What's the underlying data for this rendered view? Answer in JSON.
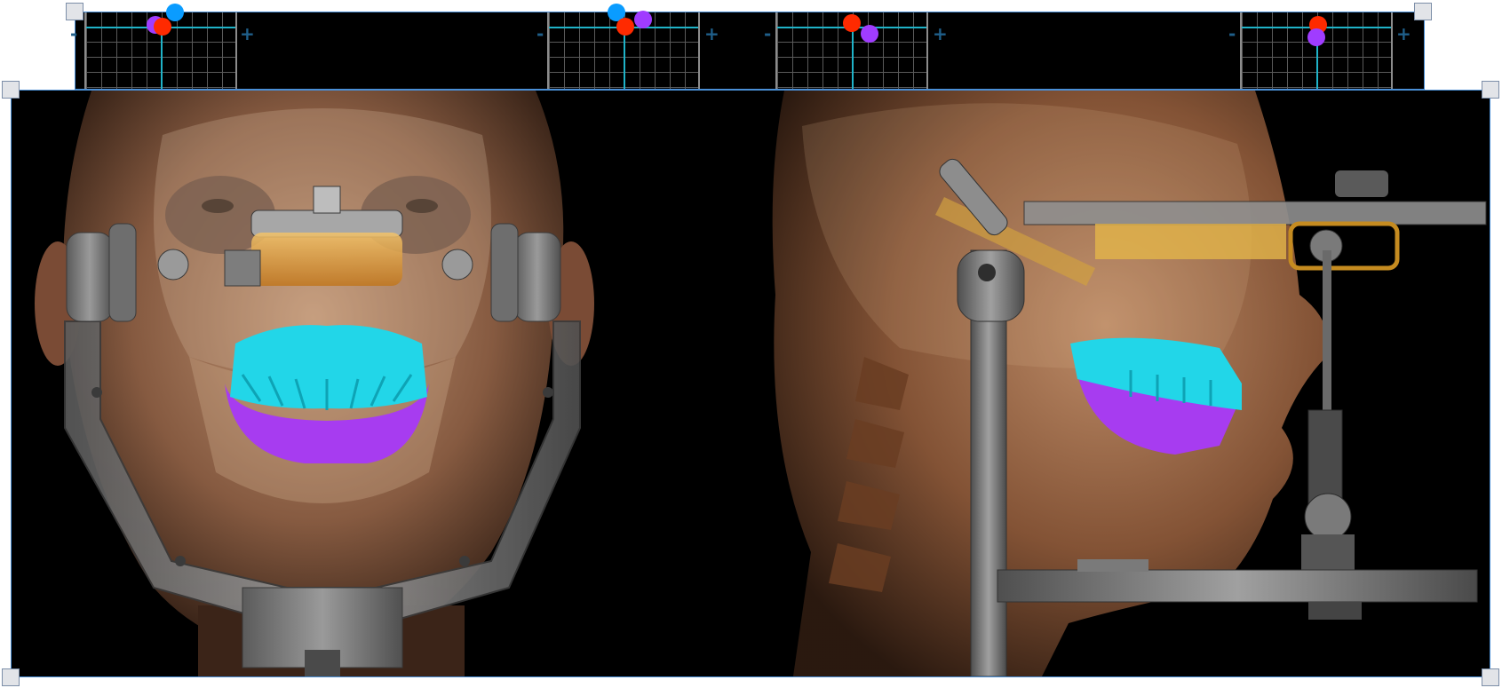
{
  "indicators": [
    {
      "id": "indicator-1",
      "minus": "-",
      "plus": "+"
    },
    {
      "id": "indicator-2",
      "minus": "-",
      "plus": "+"
    },
    {
      "id": "indicator-3",
      "minus": "-",
      "plus": "+"
    },
    {
      "id": "indicator-4",
      "minus": "-",
      "plus": "+"
    }
  ],
  "colors": {
    "frame_border": "#4a8fd6",
    "grid_line": "#5a5a5a",
    "axis_line": "#1fb3c8",
    "marker_red": "#ff2a00",
    "marker_purple": "#a03cff",
    "marker_blue": "#0a9cff",
    "upper_teeth": "#22d6e8",
    "lower_teeth": "#a73cf0"
  },
  "views": {
    "front": {
      "image": "frontal-face-articulator-view"
    },
    "side": {
      "image": "lateral-face-articulator-view"
    }
  }
}
